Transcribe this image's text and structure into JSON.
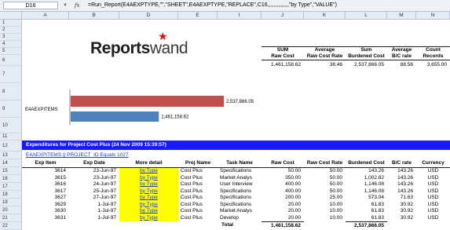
{
  "formula_bar": {
    "cell_ref": "D16",
    "fx": "fx",
    "formula": "=Run_Report(E4AEXPTYPE,\"\",\"SHEET\",E4AEXPTYPE,\"REPLACE\",C16,,,,,,,,,,,,,,\"by Type\",\"VALUE\")"
  },
  "columns": [
    "A",
    "B",
    "D",
    "E",
    "I",
    "J",
    "K",
    "L",
    "M",
    "N"
  ],
  "rows": [
    "1",
    "2",
    "3",
    "4",
    "5",
    "6",
    "7",
    "8",
    "9",
    "10",
    "11",
    "12",
    "13",
    "14",
    "15",
    "16",
    "17",
    "18",
    "19",
    "20",
    "21",
    "22",
    "23",
    "3672"
  ],
  "logo": {
    "bold": "Reports",
    "light": "wand"
  },
  "chart_data": {
    "type": "bar",
    "categories": [
      "E4AEXPITEMS"
    ],
    "series": [
      {
        "values": [
          2537866.05
        ],
        "color": "#c0504d"
      },
      {
        "values": [
          1461158.62
        ],
        "color": "#4f81bd"
      }
    ],
    "data_labels": [
      "2,537,866.05",
      "1,461,158.62"
    ],
    "category_label": "E4AEXPITEMS"
  },
  "summary": {
    "headers": [
      [
        "SUM",
        "Raw Cost"
      ],
      [
        "Average",
        "Raw Cost Rate"
      ],
      [
        "Sum",
        "Burdened Cost"
      ],
      [
        "Average",
        "B/C rate"
      ],
      [
        "Count",
        "Records"
      ]
    ],
    "values": [
      "1,461,158.62",
      "38.46",
      "2,537,866.05",
      "88.56",
      "3,655.00"
    ]
  },
  "banner": "Expenditures for Project Cost Plus (24 Nov 2009 15:39:57)",
  "filter_link": "E4AEXPITEMS || PROJECT_ID Equals 1027",
  "table": {
    "headers": [
      "Exp Item",
      "Exp Date",
      "More detail",
      "Proj Name",
      "Task Name",
      "Raw Cost",
      "Raw Cost Rate",
      "Burdened Cost",
      "B/C rate",
      "Currency"
    ],
    "rows": [
      [
        "3614",
        "23-Jun-97",
        "by Type",
        "Cost Plus",
        "Specifications",
        "50.00",
        "50.00",
        "143.26",
        "143.26",
        "USD"
      ],
      [
        "3615",
        "23-Jun-97",
        "by Type",
        "Cost Plus",
        "Market Analys",
        "350.00",
        "50.00",
        "1,002.82",
        "143.26",
        "USD"
      ],
      [
        "3616",
        "24-Jun-97",
        "by Type",
        "Cost Plus",
        "User Interview",
        "400.00",
        "50.00",
        "1,146.08",
        "143.26",
        "USD"
      ],
      [
        "3617",
        "25-Jun-97",
        "by Type",
        "Cost Plus",
        "Specifications",
        "400.00",
        "50.00",
        "1,146.08",
        "143.26",
        "USD"
      ],
      [
        "3627",
        "27-Jun-97",
        "by Type",
        "Cost Plus",
        "Specifications",
        "200.00",
        "25.00",
        "573.04",
        "71.63",
        "USD"
      ],
      [
        "3629",
        "1-Jul-97",
        "by Type",
        "Cost Plus",
        "Specifications",
        "20.00",
        "10.00",
        "61.83",
        "30.92",
        "USD"
      ],
      [
        "3630",
        "1-Jul-97",
        "by Type",
        "Cost Plus",
        "Market Analys",
        "20.00",
        "10.00",
        "61.83",
        "30.92",
        "USD"
      ],
      [
        "3631",
        "1-Jul-97",
        "by Type",
        "Cost Plus",
        "Develop",
        "20.00",
        "10.00",
        "61.83",
        "30.92",
        "USD"
      ]
    ],
    "total": {
      "label": "Total",
      "raw_cost": "1,461,158.62",
      "burdened_cost": "2,537,866.05"
    }
  }
}
